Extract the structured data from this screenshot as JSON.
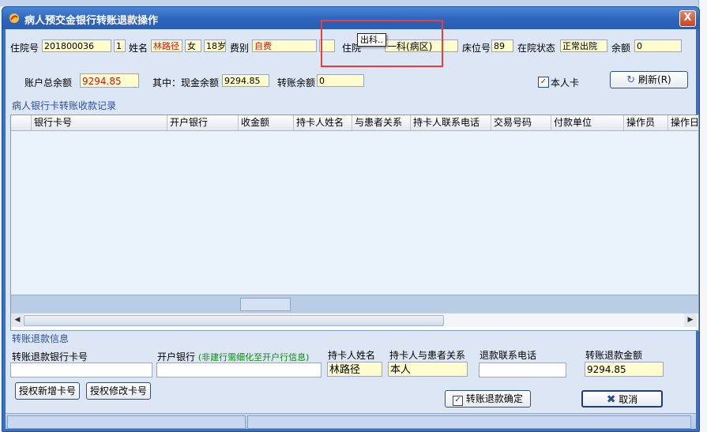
{
  "window": {
    "title": "病人预交金银行转账退款操作",
    "close_label": "X"
  },
  "patient": {
    "inpatient_no_label": "住院号",
    "inpatient_no": "201800036",
    "inpatient_seq": "1",
    "name_label": "姓名",
    "name": "林路径",
    "gender": "女",
    "age": "18岁",
    "fee_type_label": "费别",
    "fee_type": "自费",
    "ward_label": "住院",
    "ward": "一科(病区)",
    "ward_tooltip": "出科..",
    "bed_label": "床位号",
    "bed": "89",
    "status_label": "在院状态",
    "status": "正常出院",
    "balance_label": "余额",
    "balance": "0"
  },
  "account": {
    "total_label": "账户总余额",
    "total": "9294.85",
    "cash_label": "其中：现金余额",
    "cash": "9294.85",
    "transfer_label": "转账余额",
    "transfer": "0",
    "self_card_label": "本人卡",
    "self_card_checked": true,
    "refresh_label": "刷新(R)"
  },
  "records": {
    "title": "病人银行卡转账收款记录",
    "columns": [
      "银行卡号",
      "开户银行",
      "收金额",
      "持卡人姓名",
      "与患者关系",
      "持卡人联系电话",
      "交易号码",
      "付款单位",
      "操作员",
      "操作日"
    ]
  },
  "refund": {
    "title": "转账退款信息",
    "card_label": "转账退款银行卡号",
    "card_value": "",
    "bank_label": "开户银行",
    "bank_hint": "(非建行需细化至开户行信息)",
    "bank_value": "",
    "holder_label": "持卡人姓名",
    "holder": "林路径",
    "relation_label": "持卡人与患者关系",
    "relation": "本人",
    "phone_label": "退款联系电话",
    "phone": "",
    "amount_label": "转账退款金额",
    "amount": "9294.85",
    "auth_new_label": "授权新增卡号",
    "auth_edit_label": "授权修改卡号",
    "confirm_label": "转账退款确定",
    "cancel_label": "取消"
  },
  "colors": {
    "title_blue": "#2d64bd",
    "field_yellow": "#fffccd",
    "red_text": "#d11111",
    "highlight_red": "#ee3b3b",
    "group_title": "#2a4fa8"
  }
}
